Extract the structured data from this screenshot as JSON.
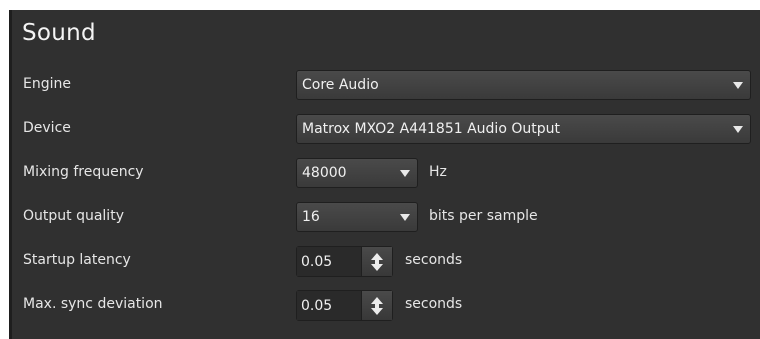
{
  "section": {
    "title": "Sound"
  },
  "engine": {
    "label": "Engine",
    "value": "Core Audio"
  },
  "device": {
    "label": "Device",
    "value": "Matrox MXO2 A441851 Audio Output"
  },
  "mixing_frequency": {
    "label": "Mixing frequency",
    "value": "48000",
    "unit": "Hz"
  },
  "output_quality": {
    "label": "Output quality",
    "value": "16",
    "unit": "bits per sample"
  },
  "startup_latency": {
    "label": "Startup latency",
    "value": "0.05",
    "unit": "seconds"
  },
  "max_sync_deviation": {
    "label": "Max. sync deviation",
    "value": "0.05",
    "unit": "seconds"
  },
  "icons": {
    "dropdown": "chevron-down-icon",
    "stepper": "up-down-arrows-icon"
  }
}
